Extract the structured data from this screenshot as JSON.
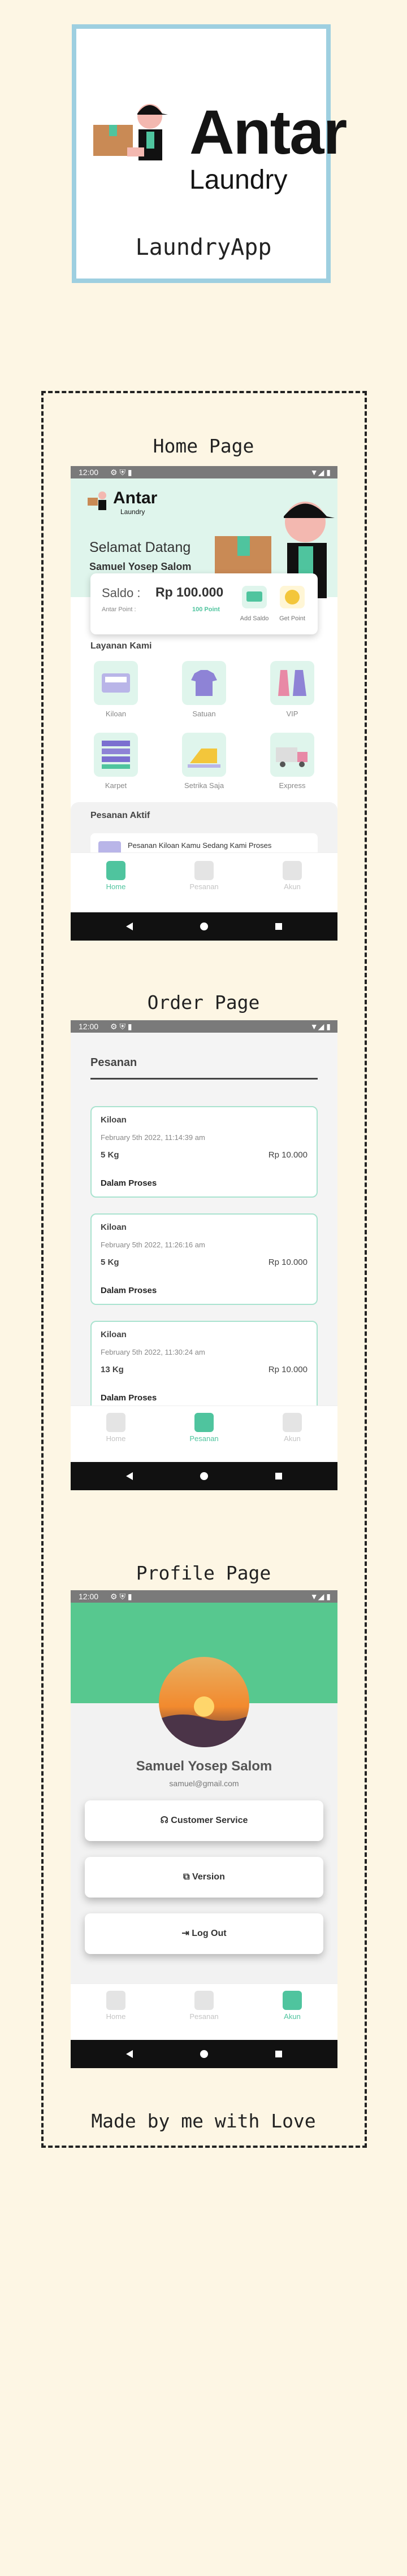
{
  "logo": {
    "title": "Antar",
    "subtitle": "Laundry"
  },
  "app_label": "LaundryApp",
  "sections": {
    "home": "Home Page",
    "order": "Order Page",
    "profile": "Profile Page"
  },
  "footer": "Made by me with Love",
  "status_time": "12:00",
  "home": {
    "logo_title": "Antar",
    "logo_sub": "Laundry",
    "greeting": "Selamat Datang",
    "user_name": "Samuel Yosep Salom",
    "saldo_label": "Saldo :",
    "saldo_value": "Rp 100.000",
    "point_label": "Antar Point :",
    "point_value": "100 Point",
    "add_saldo": "Add Saldo",
    "get_point": "Get Point",
    "services_title": "Layanan Kami",
    "services": [
      {
        "label": "Kiloan",
        "icon": "scale-icon"
      },
      {
        "label": "Satuan",
        "icon": "shirt-icon"
      },
      {
        "label": "VIP",
        "icon": "dress-icon"
      },
      {
        "label": "Karpet",
        "icon": "carpet-icon"
      },
      {
        "label": "Setrika Saja",
        "icon": "iron-icon"
      },
      {
        "label": "Express",
        "icon": "truck-icon"
      }
    ],
    "active_orders_title": "Pesanan Aktif",
    "active_order_preview": "Pesanan Kiloan Kamu Sedang Kami Proses"
  },
  "tabs": [
    {
      "label": "Home",
      "icon": "home-icon"
    },
    {
      "label": "Pesanan",
      "icon": "order-icon"
    },
    {
      "label": "Akun",
      "icon": "account-icon"
    }
  ],
  "orders": {
    "title": "Pesanan",
    "items": [
      {
        "type": "Kiloan",
        "date": "February 5th 2022, 11:14:39 am",
        "weight": "5 Kg",
        "price": "Rp 10.000",
        "status": "Dalam Proses"
      },
      {
        "type": "Kiloan",
        "date": "February 5th 2022, 11:26:16 am",
        "weight": "5 Kg",
        "price": "Rp 10.000",
        "status": "Dalam Proses"
      },
      {
        "type": "Kiloan",
        "date": "February 5th 2022, 11:30:24 am",
        "weight": "13 Kg",
        "price": "Rp 10.000",
        "status": "Dalam Proses"
      }
    ]
  },
  "profile": {
    "name": "Samuel Yosep Salom",
    "email": "samuel@gmail.com",
    "buttons": [
      {
        "label": "Customer Service",
        "icon": "headset-icon"
      },
      {
        "label": "Version",
        "icon": "version-icon"
      },
      {
        "label": "Log Out",
        "icon": "logout-icon"
      }
    ]
  },
  "colors": {
    "accent": "#4fc49e",
    "header_green": "#57c88f",
    "frame_blue": "#9ecfe0",
    "background": "#fdf6e4"
  }
}
